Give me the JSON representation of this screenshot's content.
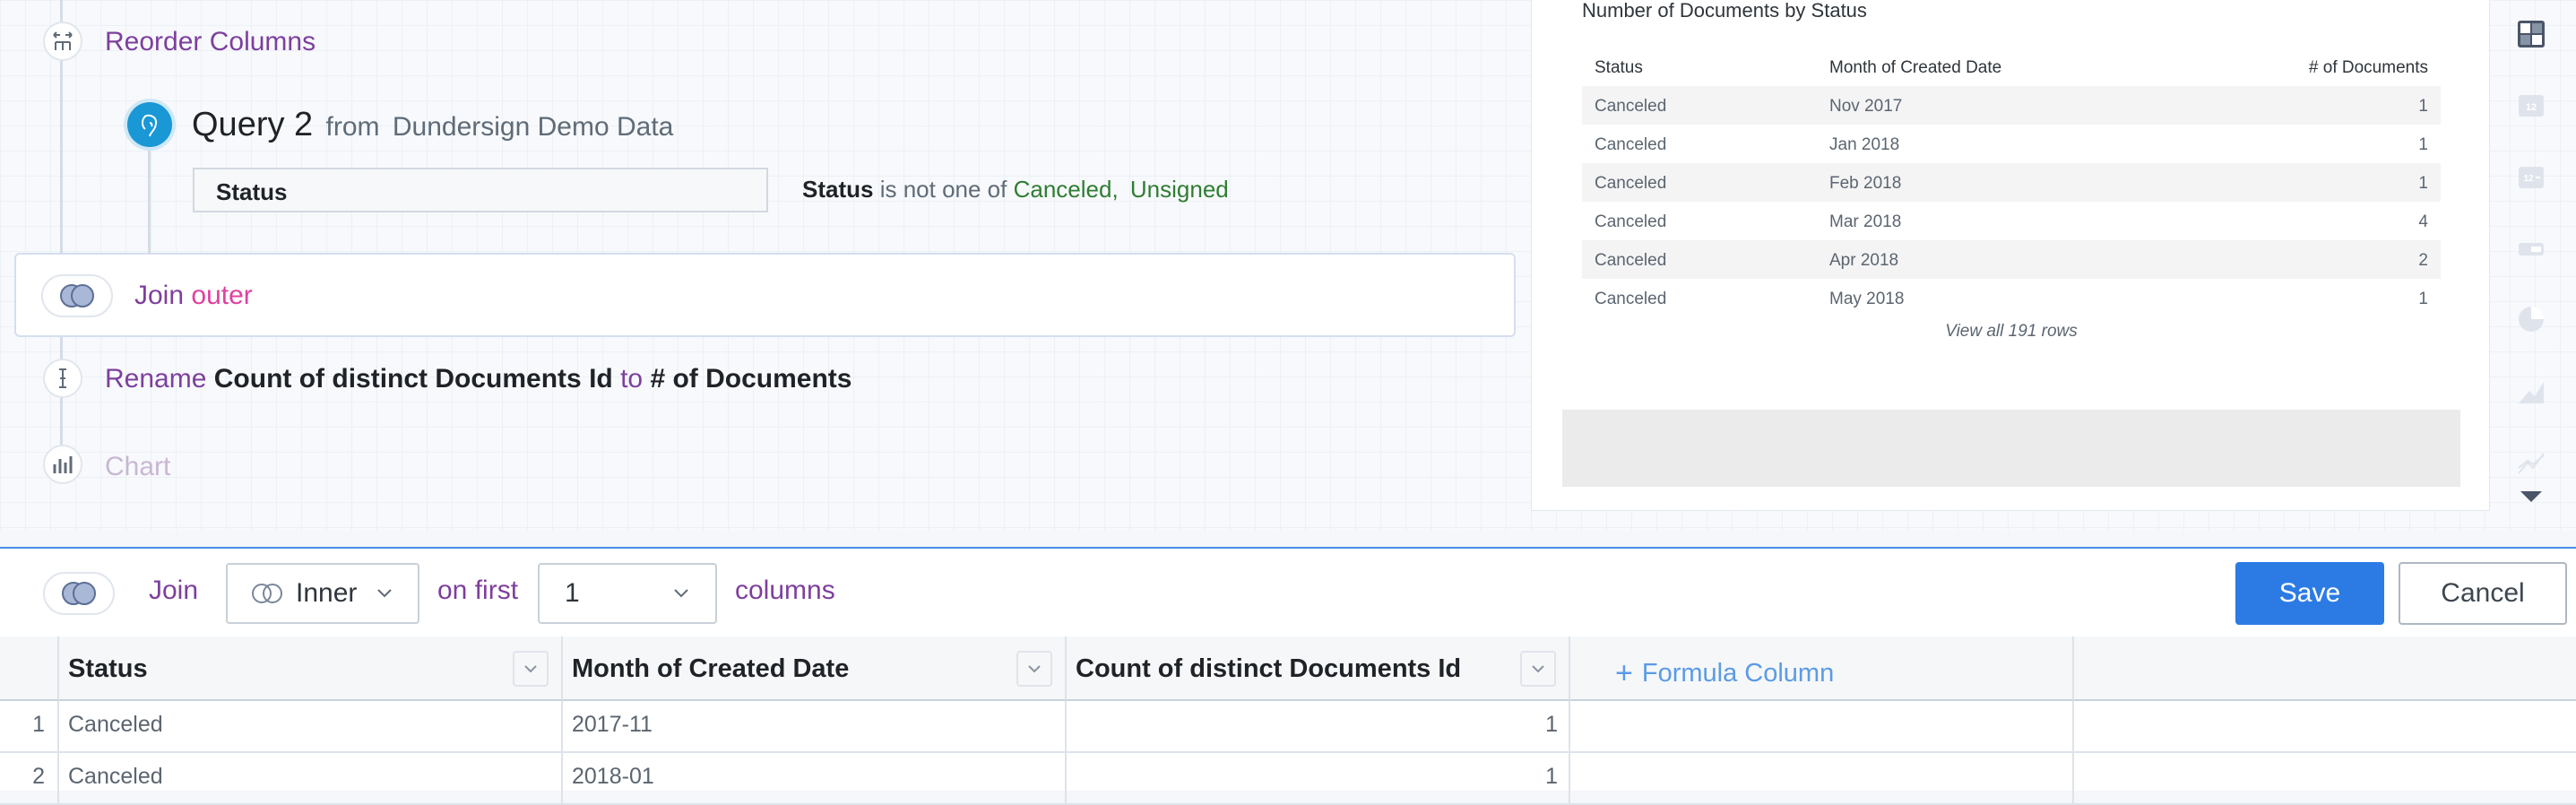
{
  "steps": {
    "reorder_label": "Reorder Columns",
    "query_title": "Query 2",
    "query_from": "from",
    "query_source": "Dundersign Demo Data",
    "filter_column": "Status",
    "filter_text_column": "Status",
    "filter_operator": "is not one of",
    "filter_value_1": "Canceled,",
    "filter_value_2": "Unsigned",
    "join_label": "Join",
    "join_type": "outer",
    "rename_label": "Rename",
    "rename_from": "Count of distinct Documents Id",
    "rename_to_word": "to",
    "rename_to": "# of Documents",
    "chart_label": "Chart"
  },
  "preview": {
    "title": "Number of Documents by Status",
    "columns": [
      "Status",
      "Month of Created Date",
      "# of Documents"
    ],
    "rows": [
      [
        "Canceled",
        "Nov 2017",
        "1"
      ],
      [
        "Canceled",
        "Jan 2018",
        "1"
      ],
      [
        "Canceled",
        "Feb 2018",
        "1"
      ],
      [
        "Canceled",
        "Mar 2018",
        "4"
      ],
      [
        "Canceled",
        "Apr 2018",
        "2"
      ],
      [
        "Canceled",
        "May 2018",
        "1"
      ]
    ],
    "view_all": "View all 191 rows"
  },
  "sidebar": {
    "icons": [
      "pivot-table-icon",
      "number-icon",
      "number-trend-icon",
      "progress-icon",
      "pie-chart-icon",
      "area-chart-icon",
      "line-chart-icon",
      "more-down-icon"
    ],
    "number_label": "12",
    "number_trend_label": "12"
  },
  "toolbar": {
    "join_label": "Join",
    "join_type": "Inner",
    "on_first_label": "on first",
    "columns_count": "1",
    "columns_label": "columns",
    "save_label": "Save",
    "cancel_label": "Cancel"
  },
  "grid": {
    "headers": [
      "Status",
      "Month of Created Date",
      "Count of distinct Documents Id"
    ],
    "formula_label": "Formula Column",
    "rows": [
      {
        "num": "1",
        "status": "Canceled",
        "month": "2017-11",
        "count": "1"
      },
      {
        "num": "2",
        "status": "Canceled",
        "month": "2018-01",
        "count": "1"
      }
    ]
  },
  "colors": {
    "accent_blue": "#2c7be5",
    "purple_text": "#7e3f9d",
    "pink_text": "#e040a0",
    "green_value": "#2f7d32",
    "query_icon": "#1a97d5"
  }
}
